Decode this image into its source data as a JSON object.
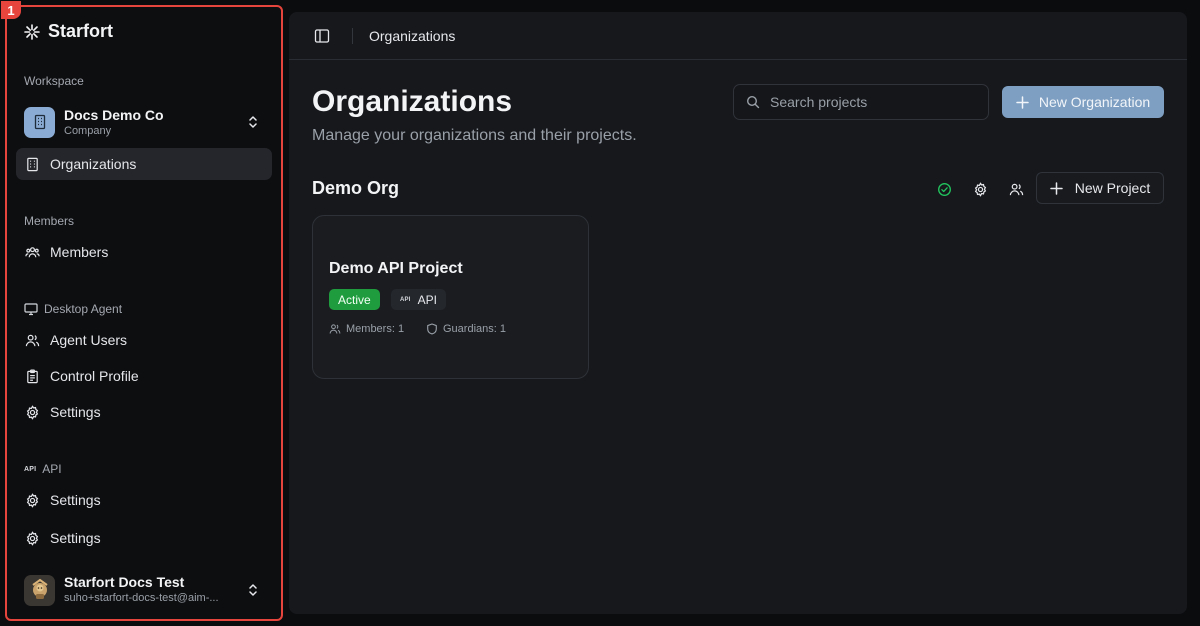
{
  "sidebar": {
    "marker": "1",
    "brand": "Starfort",
    "workspace_label": "Workspace",
    "workspace": {
      "name": "Docs Demo Co",
      "type": "Company"
    },
    "nav_organizations": "Organizations",
    "members_label": "Members",
    "nav_members": "Members",
    "desktop_agent_label": "Desktop Agent",
    "nav_agent_users": "Agent Users",
    "nav_control_profile": "Control Profile",
    "nav_desktop_settings": "Settings",
    "api_glyph": "API",
    "api_label": "API",
    "nav_api_settings": "Settings",
    "nav_settings": "Settings",
    "user": {
      "name": "Starfort Docs Test",
      "email": "suho+starfort-docs-test@aim-..."
    }
  },
  "topbar": {
    "title": "Organizations"
  },
  "page": {
    "title": "Organizations",
    "subtitle": "Manage your organizations and their projects.",
    "search_placeholder": "Search projects",
    "new_org_label": "New Organization"
  },
  "org": {
    "name": "Demo Org",
    "new_project_label": "New Project",
    "project": {
      "name": "Demo API Project",
      "status": "Active",
      "type_glyph": "API",
      "type": "API",
      "members": "Members: 1",
      "guardians": "Guardians: 1"
    }
  },
  "colors": {
    "accent": "#7e9fc2",
    "active_badge": "#1f9d3e",
    "status_ok": "#22c55e",
    "highlight_border": "#e5453c"
  },
  "icons": [
    "starfort-logo-icon",
    "building-icon",
    "chevrons-up-down-icon",
    "users-group-icon",
    "monitor-icon",
    "users-icon",
    "clipboard-icon",
    "gear-icon",
    "api-icon",
    "sidebar-toggle-icon",
    "search-icon",
    "plus-icon",
    "check-circle-icon",
    "shield-icon"
  ]
}
